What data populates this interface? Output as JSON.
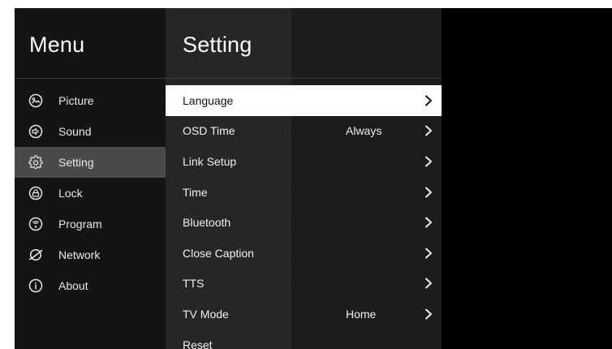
{
  "menu": {
    "title": "Menu",
    "items": [
      {
        "label": "Picture",
        "icon": "picture-icon"
      },
      {
        "label": "Sound",
        "icon": "sound-icon"
      },
      {
        "label": "Setting",
        "icon": "gear-icon",
        "selected": true
      },
      {
        "label": "Lock",
        "icon": "lock-icon"
      },
      {
        "label": "Program",
        "icon": "program-icon"
      },
      {
        "label": "Network",
        "icon": "network-icon"
      },
      {
        "label": "About",
        "icon": "info-icon"
      }
    ]
  },
  "setting": {
    "title": "Setting",
    "items": [
      {
        "label": "Language",
        "value": "",
        "focused": true
      },
      {
        "label": "OSD Time",
        "value": "Always"
      },
      {
        "label": "Link Setup",
        "value": ""
      },
      {
        "label": "Time",
        "value": ""
      },
      {
        "label": "Bluetooth",
        "value": ""
      },
      {
        "label": "Close Caption",
        "value": ""
      },
      {
        "label": "TTS",
        "value": ""
      },
      {
        "label": "TV Mode",
        "value": "Home"
      },
      {
        "label": "Reset",
        "value": ""
      }
    ]
  },
  "colors": {
    "background": "#000000",
    "menu_panel": "#141414",
    "settings_panel": "#262626",
    "selected_item": "#4a4a4a",
    "focused_item": "#ffffff"
  }
}
